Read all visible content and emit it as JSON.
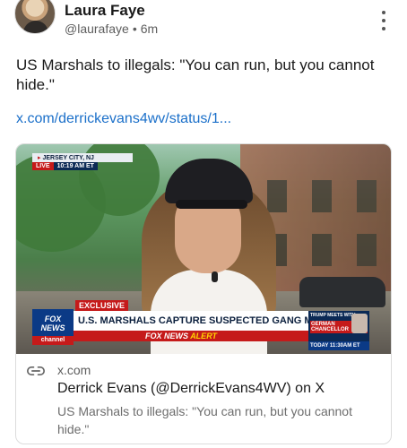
{
  "post": {
    "author_name": "Laura Faye",
    "handle": "@laurafaye",
    "separator": "•",
    "time_ago": "6m",
    "text": "US Marshals to illegals: \"You can run, but you cannot hide.\"",
    "link_text": "x.com/derrickevans4wv/status/1..."
  },
  "card": {
    "domain": "x.com",
    "title": "Derrick Evans (@DerrickEvans4WV) on X",
    "description": "US Marshals to illegals: \"You can run, but you cannot hide.\"",
    "broadcast": {
      "location": "JERSEY CITY, NJ",
      "live_label": "LIVE",
      "live_time": "10:19 AM ET",
      "exclusive_label": "EXCLUSIVE",
      "headline": "U.S. MARSHALS CAPTURE SUSPECTED GANG MEMBERS",
      "channel_logo_line1": "FOX",
      "channel_logo_line2": "NEWS",
      "channel_logo_line3": "channel",
      "alert_brand": "FOX NEWS",
      "alert_word": "ALERT",
      "side_top": "TRUMP MEETS WITH",
      "side_red": "GERMAN CHANCELLOR",
      "side_time": "TODAY 11:30AM ET"
    }
  },
  "icons": {
    "more": "more-vertical-icon",
    "link": "link-icon"
  }
}
